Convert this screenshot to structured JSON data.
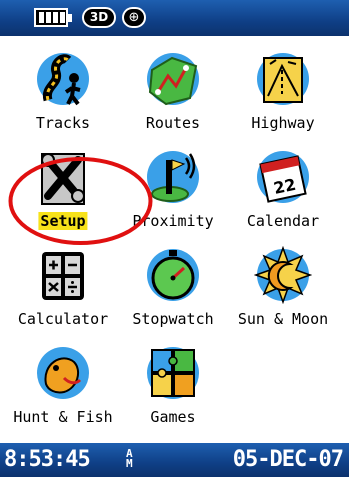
{
  "status_bar": {
    "badge_3d": "3D",
    "compass_glyph": "⊕"
  },
  "menu": {
    "items": [
      {
        "label": "Tracks",
        "icon": "tracks-icon"
      },
      {
        "label": "Routes",
        "icon": "routes-icon"
      },
      {
        "label": "Highway",
        "icon": "highway-icon"
      },
      {
        "label": "Setup",
        "icon": "wrench-icon",
        "selected": true
      },
      {
        "label": "Proximity",
        "icon": "proximity-icon"
      },
      {
        "label": "Calendar",
        "icon": "calendar-icon"
      },
      {
        "label": "Calculator",
        "icon": "calculator-icon"
      },
      {
        "label": "Stopwatch",
        "icon": "stopwatch-icon"
      },
      {
        "label": "Sun & Moon",
        "icon": "sun-moon-icon"
      },
      {
        "label": "Hunt & Fish",
        "icon": "fish-icon"
      },
      {
        "label": "Games",
        "icon": "puzzle-icon"
      }
    ]
  },
  "bottom_bar": {
    "time": "8:53:45",
    "ampm_top": "A",
    "ampm_bottom": "M",
    "date": "05-DEC-07"
  },
  "colors": {
    "bar_blue": "#0f3f86",
    "selection_yellow": "#f7e21a",
    "highlight_ring": "#e01010"
  }
}
